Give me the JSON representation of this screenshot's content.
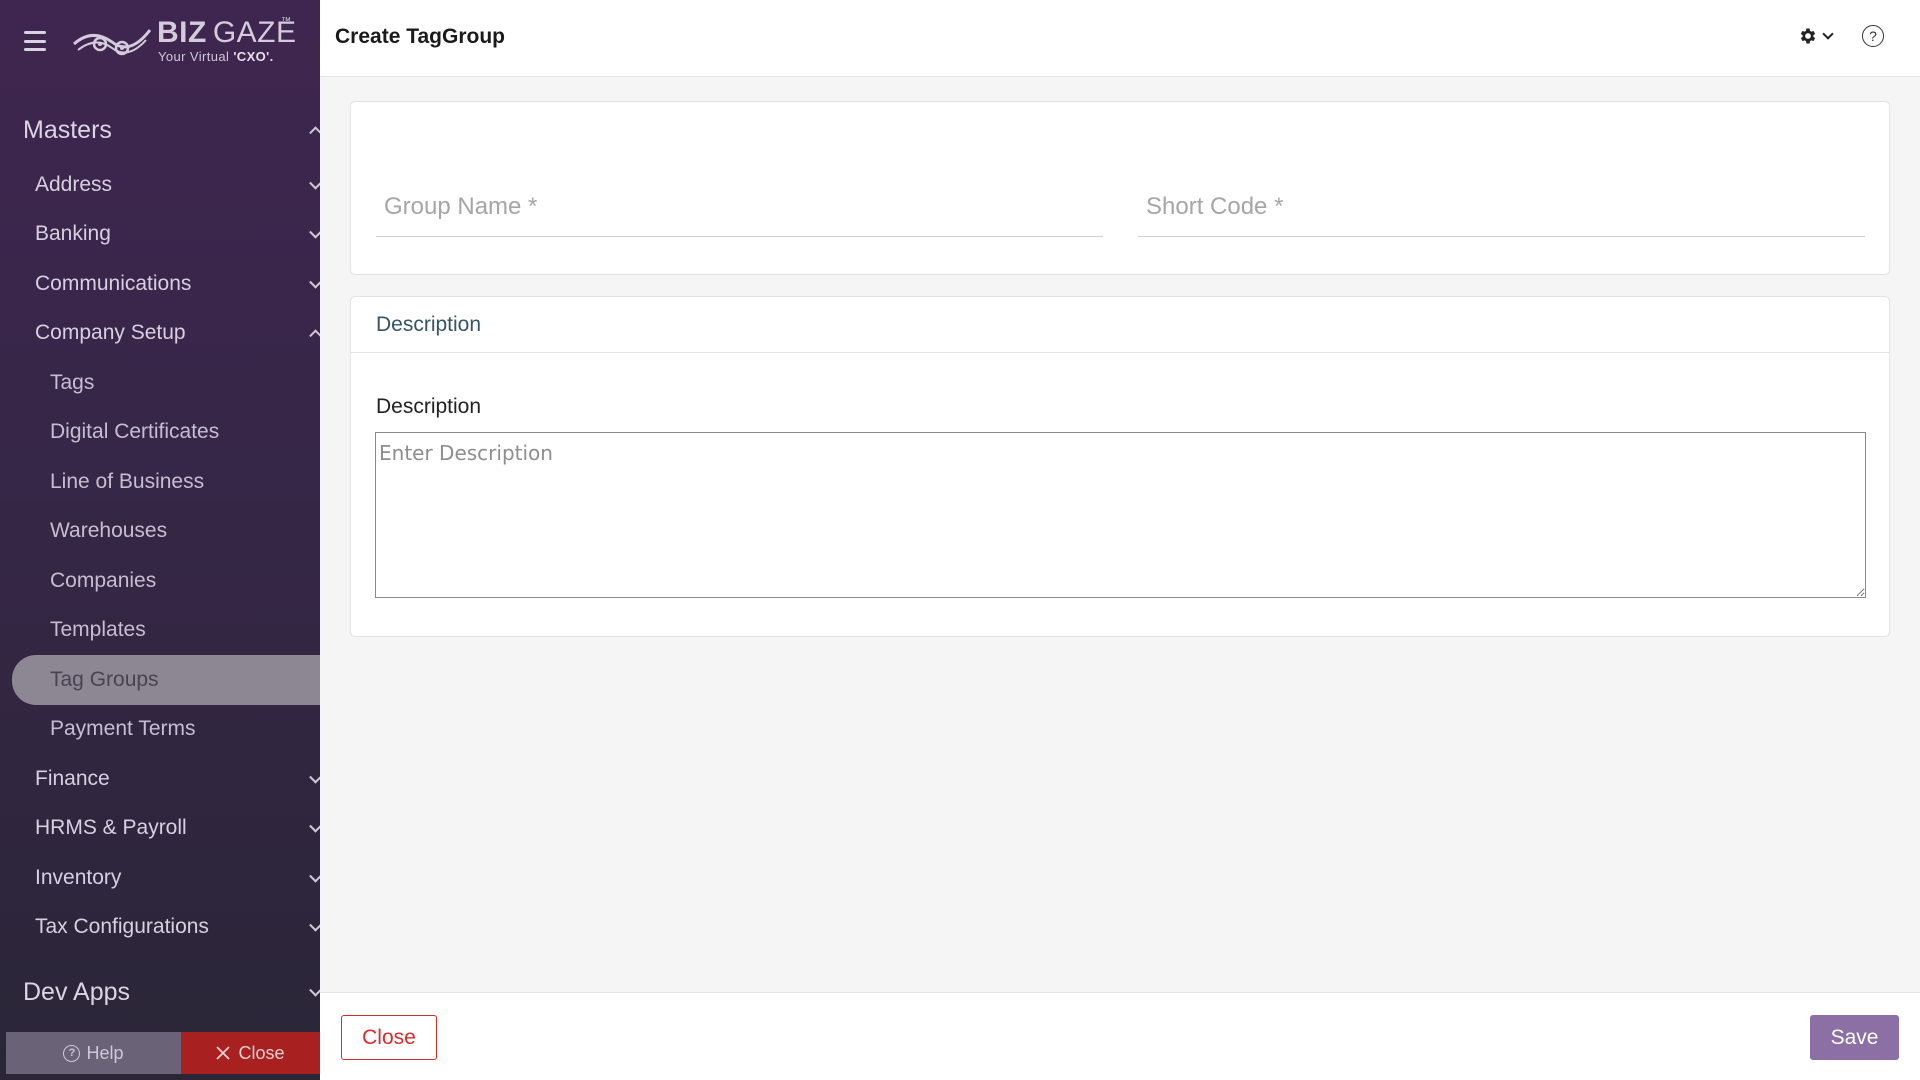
{
  "app": {
    "brand_bold": "BIZ",
    "brand_light": "GAZE",
    "brand_tm": "™",
    "tagline_prefix": "Your Virtual ",
    "tagline_bold": "'CXO'."
  },
  "sidebar": {
    "sections": {
      "masters": "Masters",
      "dev_apps": "Dev Apps"
    },
    "items": {
      "address": "Address",
      "banking": "Banking",
      "communications": "Communications",
      "company_setup": "Company Setup",
      "finance": "Finance",
      "hrms_payroll": "HRMS & Payroll",
      "inventory": "Inventory",
      "tax_configurations": "Tax Configurations"
    },
    "company_setup_children": {
      "tags": "Tags",
      "digital_certificates": "Digital Certificates",
      "line_of_business": "Line of Business",
      "warehouses": "Warehouses",
      "companies": "Companies",
      "templates": "Templates",
      "tag_groups": "Tag Groups",
      "payment_terms": "Payment Terms"
    },
    "active_item": "Tag Groups",
    "footer": {
      "help_label": "Help",
      "close_label": "Close"
    }
  },
  "header": {
    "title": "Create TagGroup",
    "help_symbol": "?"
  },
  "form": {
    "group_name_placeholder": "Group Name *",
    "short_code_placeholder": "Short Code *",
    "description_section_title": "Description",
    "description_label": "Description",
    "description_placeholder": "Enter Description"
  },
  "footer": {
    "close_label": "Close",
    "save_label": "Save"
  },
  "icons": {
    "menu": "hamburger-icon",
    "logo": "owl-logo-icon",
    "settings": "gear-icon",
    "dropdown": "chevron-down-icon",
    "help": "help-circle-icon",
    "close": "x-icon"
  },
  "colors": {
    "sidebar_bg": "#3f2650",
    "active_item_bg": "#8d8794",
    "save_button": "#8c6fa4",
    "close_button": "#d62c2c",
    "sidebar_close_bg": "#a82020",
    "section_title": "#355466"
  }
}
